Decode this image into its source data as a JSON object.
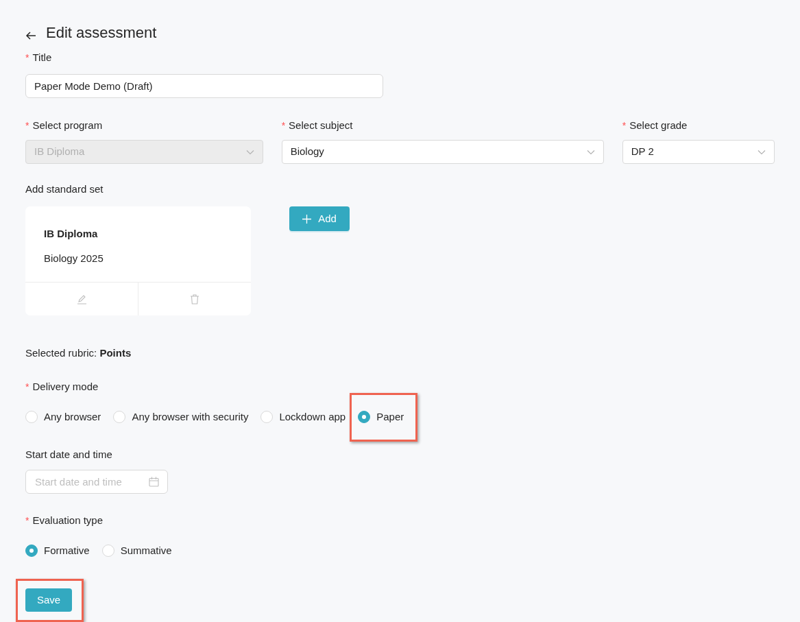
{
  "header": {
    "title": "Edit assessment"
  },
  "title_field": {
    "label": "Title",
    "required_mark": "*",
    "value": "Paper Mode Demo (Draft)"
  },
  "selects": [
    {
      "label": "Select program",
      "required_mark": "*",
      "value": "IB Diploma",
      "disabled": true
    },
    {
      "label": "Select subject",
      "required_mark": "*",
      "value": "Biology",
      "disabled": false
    },
    {
      "label": "Select grade",
      "required_mark": "*",
      "value": "DP 2",
      "disabled": false
    }
  ],
  "standard_set": {
    "label": "Add standard set",
    "cards": [
      {
        "title": "IB Diploma",
        "subtitle": "Biology 2025"
      }
    ],
    "add_button": "Add"
  },
  "rubric": "Selected rubric: **Points**",
  "delivery_mode": {
    "label": "Delivery mode",
    "required_mark": "*",
    "options": [
      {
        "label": "Any browser",
        "selected": false,
        "highlighted": false
      },
      {
        "label": "Any browser with security",
        "selected": false,
        "highlighted": false
      },
      {
        "label": "Lockdown app",
        "selected": false,
        "highlighted": false
      },
      {
        "label": "Paper",
        "selected": true,
        "highlighted": true
      }
    ]
  },
  "start_date": {
    "label": "Start date and time",
    "placeholder": "Start date and time"
  },
  "evaluation_type": {
    "label": "Evaluation type",
    "required_mark": "*",
    "options": [
      {
        "label": "Formative",
        "selected": true,
        "highlighted": false
      },
      {
        "label": "Summative",
        "selected": false,
        "highlighted": false
      }
    ]
  },
  "save_button": {
    "label": "Save",
    "highlighted": true
  }
}
